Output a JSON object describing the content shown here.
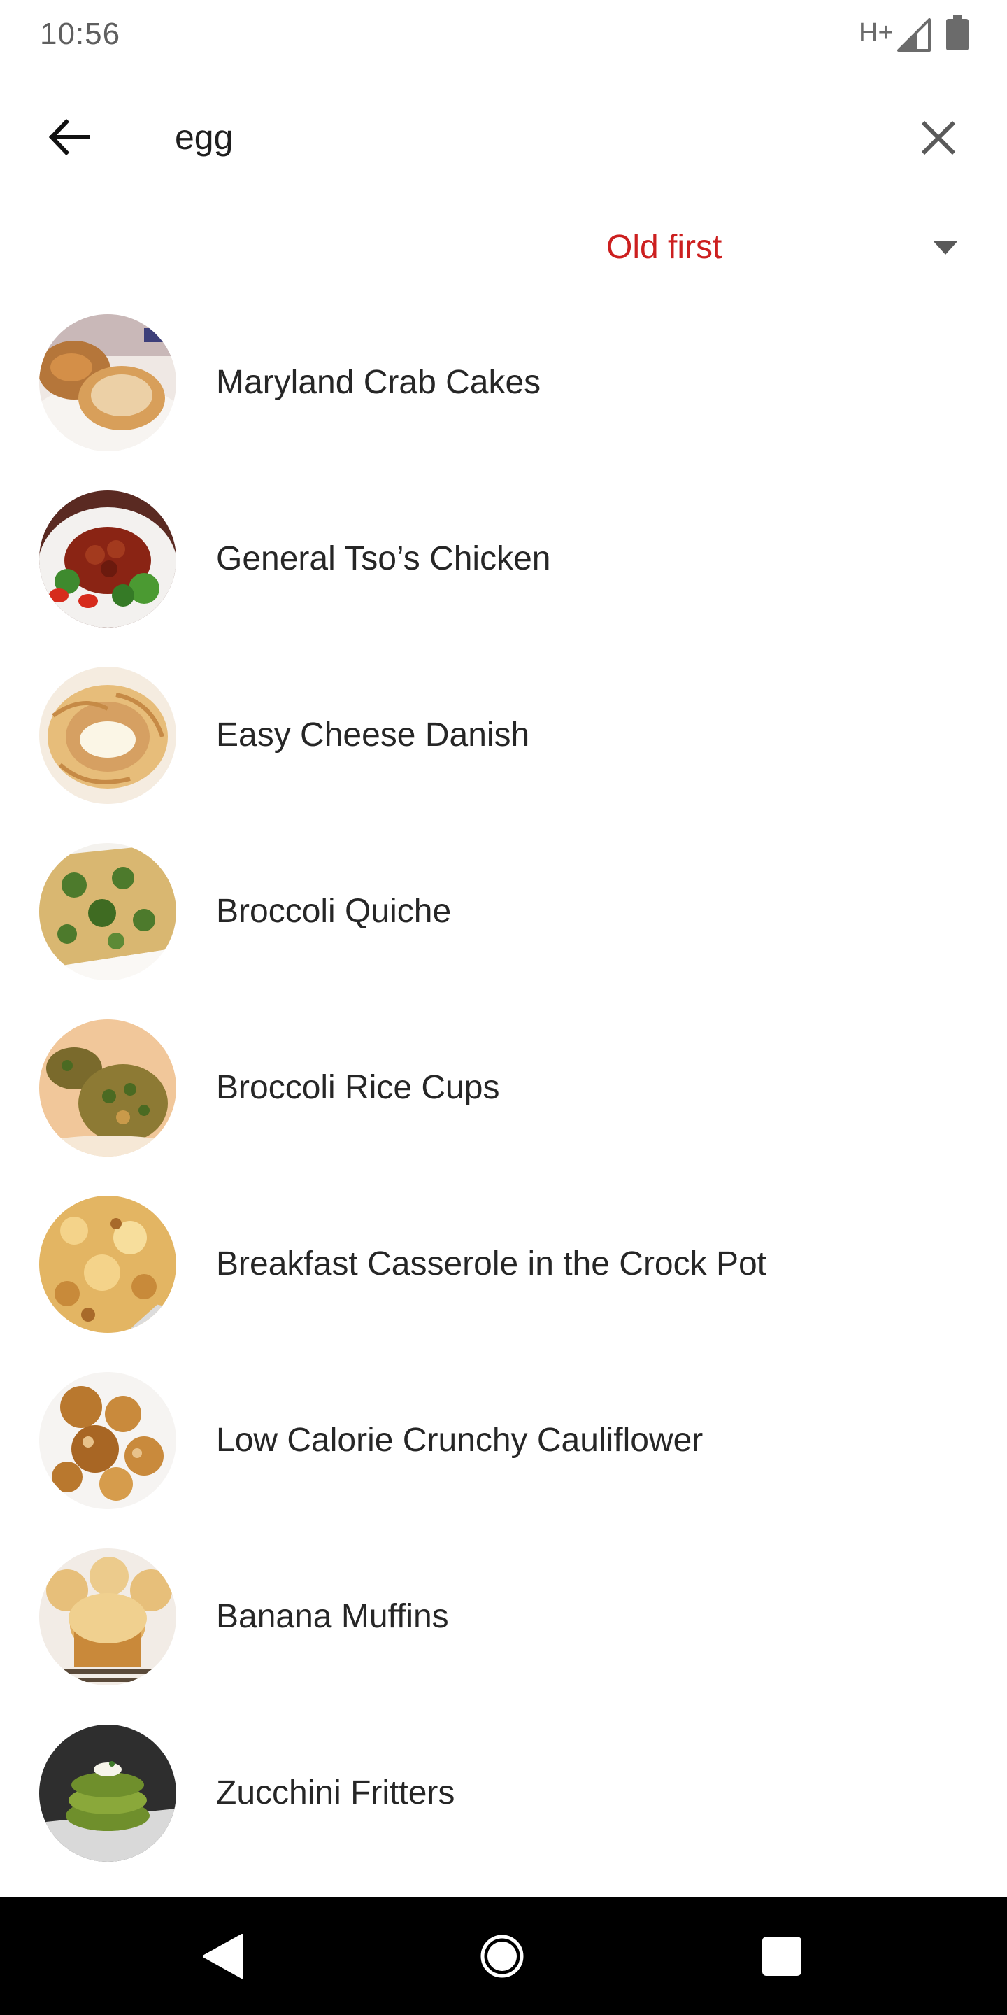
{
  "status_bar": {
    "time": "10:56",
    "network": "H+",
    "signal_icon": "cell-signal-icon",
    "battery_icon": "battery-icon"
  },
  "search": {
    "value": "egg",
    "back_icon": "arrow-left-icon",
    "clear_icon": "close-icon"
  },
  "sort": {
    "label": "Old first",
    "accent_color": "#cc1f1f",
    "arrow_icon": "triangle-down-icon"
  },
  "recipes": [
    {
      "title": "Maryland Crab Cakes"
    },
    {
      "title": "General Tso’s Chicken"
    },
    {
      "title": "Easy Cheese Danish"
    },
    {
      "title": "Broccoli Quiche"
    },
    {
      "title": "Broccoli Rice Cups"
    },
    {
      "title": "Breakfast Casserole in the Crock Pot"
    },
    {
      "title": "Low Calorie Crunchy Cauliflower"
    },
    {
      "title": "Banana Muffins"
    },
    {
      "title": "Zucchini Fritters"
    }
  ],
  "nav_bar": {
    "back_icon": "nav-back-triangle-icon",
    "home_icon": "nav-home-circle-icon",
    "recents_icon": "nav-recents-square-icon"
  }
}
